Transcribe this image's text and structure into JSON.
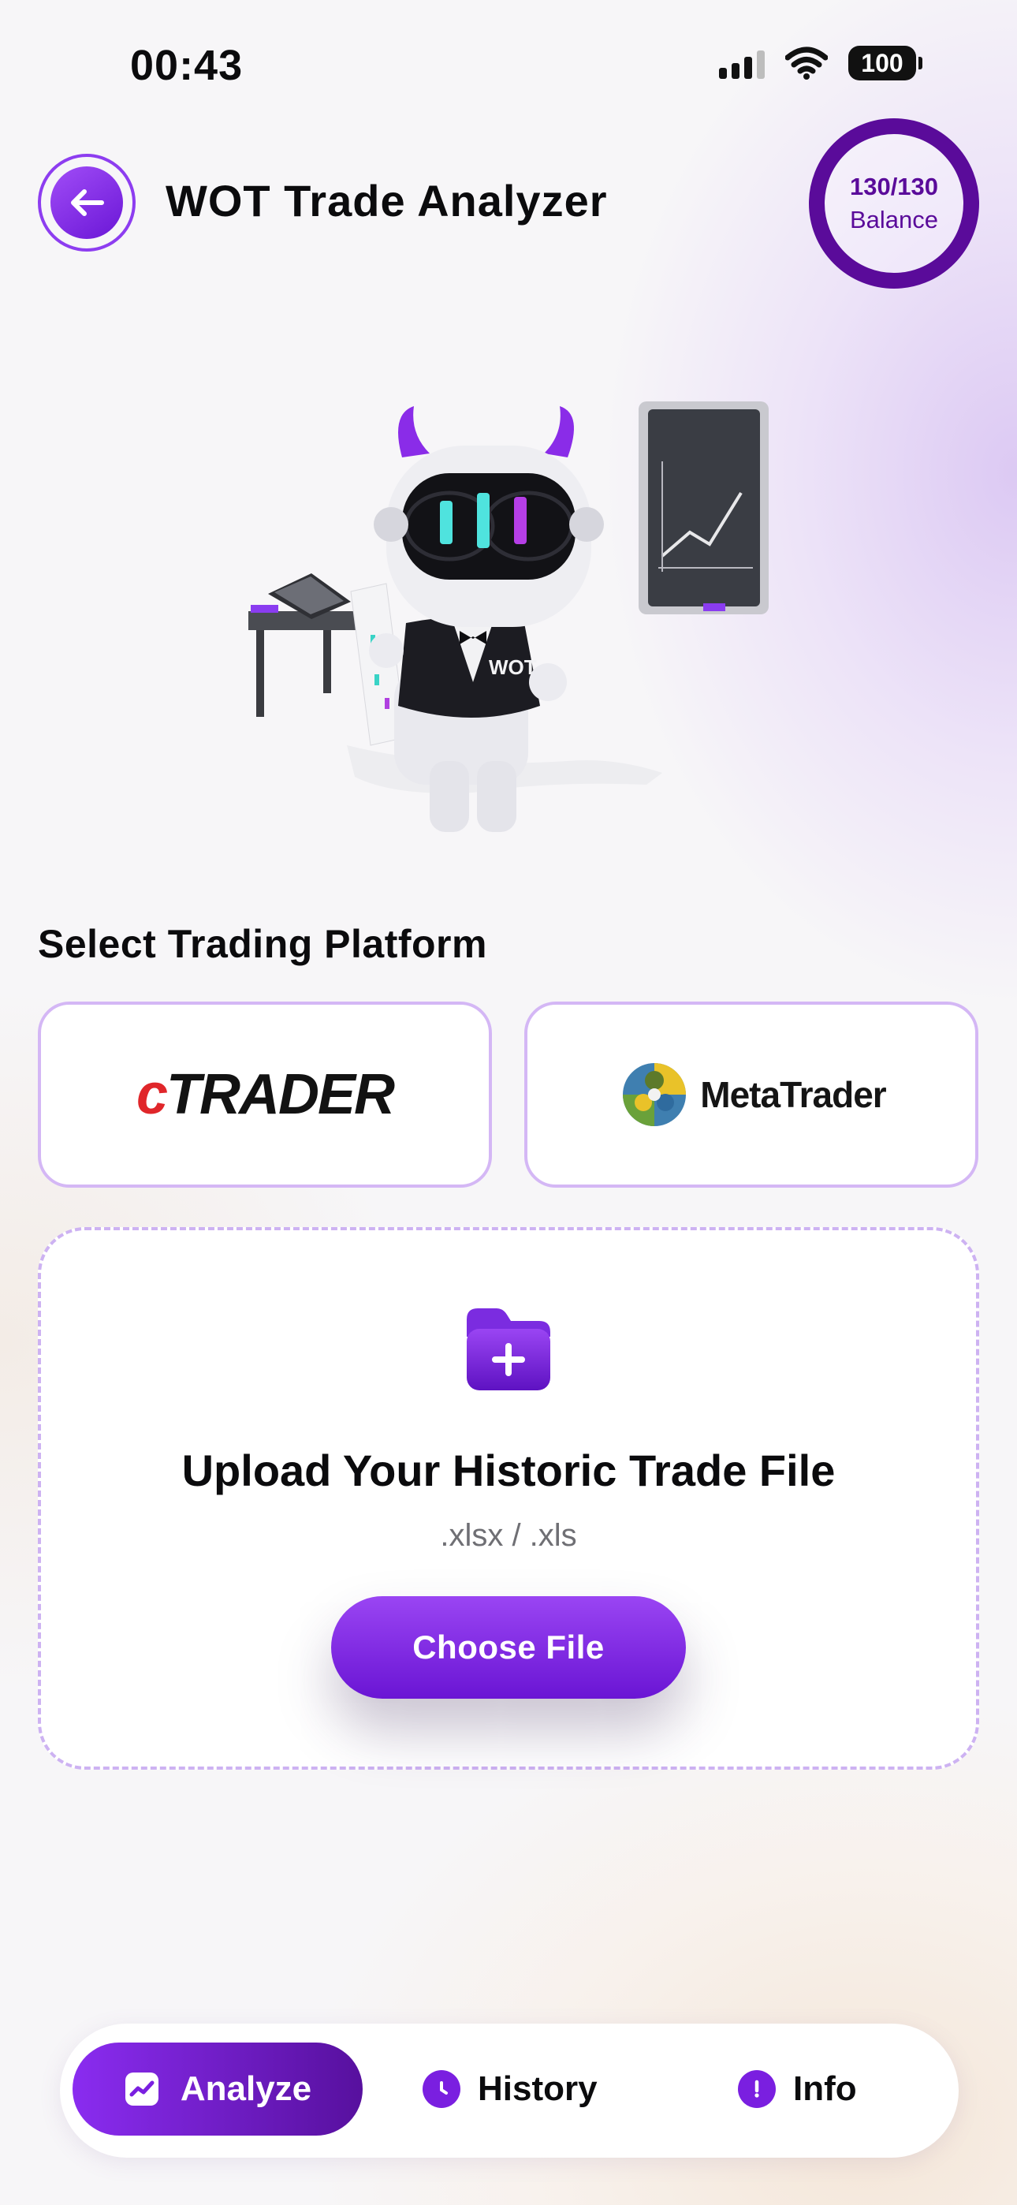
{
  "status_bar": {
    "time": "00:43",
    "battery": "100"
  },
  "header": {
    "title": "WOT Trade Analyzer",
    "balance_count": "130/130",
    "balance_label": "Balance"
  },
  "platforms": {
    "section_title": "Select Trading Platform",
    "ctrader_logo_c": "c",
    "ctrader_logo_rest": "TRADER",
    "metatrader_label": "MetaTrader"
  },
  "upload": {
    "title": "Upload Your Historic Trade File",
    "formats": ".xlsx / .xls",
    "button_label": "Choose File"
  },
  "bottom_nav": {
    "items": [
      {
        "label": "Analyze",
        "icon": "chart-trend-icon",
        "active": true
      },
      {
        "label": "History",
        "icon": "clock-icon",
        "active": false
      },
      {
        "label": "Info",
        "icon": "exclamation-icon",
        "active": false
      }
    ]
  },
  "colors": {
    "accent": "#7a1fe0",
    "balance_ring": "#5a0b9a",
    "card_border": "#d4b7f5"
  }
}
